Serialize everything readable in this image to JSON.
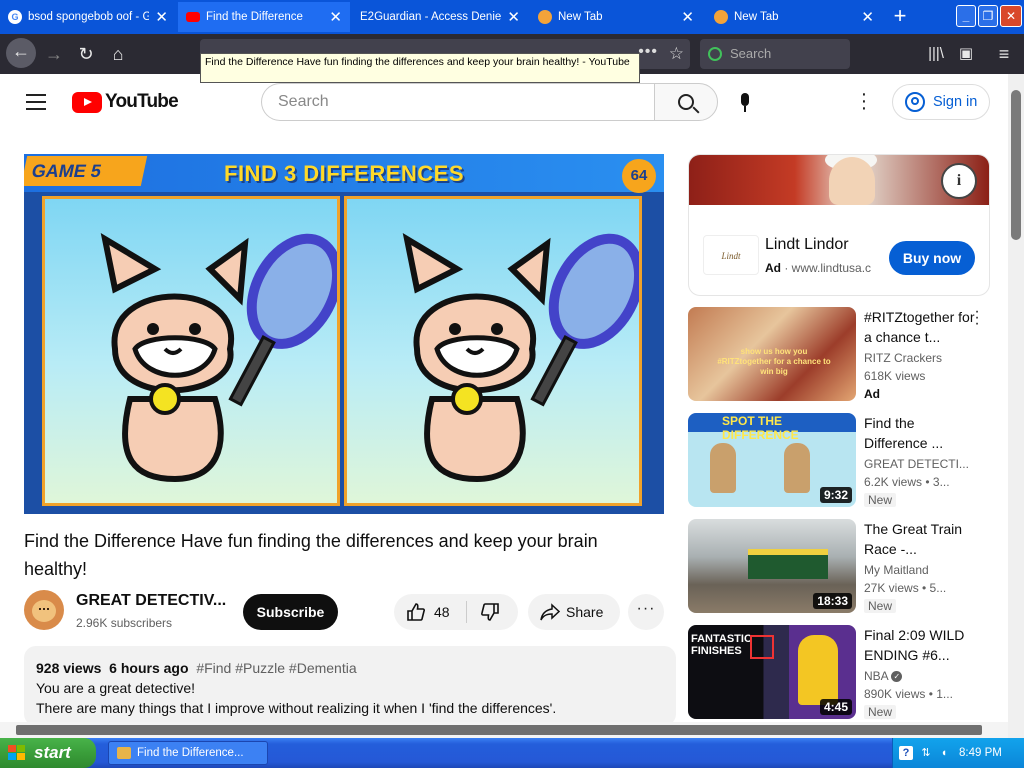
{
  "browser": {
    "tabs": [
      {
        "title": "bsod spongebob oof - G",
        "favicon": "google-icon",
        "active": false
      },
      {
        "title": "Find the Difference",
        "favicon": "youtube-icon",
        "active": true
      },
      {
        "title": "E2Guardian - Access Denied",
        "favicon": "",
        "active": false
      },
      {
        "title": "New Tab",
        "favicon": "firefox-icon",
        "active": false
      },
      {
        "title": "New Tab",
        "favicon": "firefox-icon",
        "active": false
      }
    ],
    "new_tab_label": "+",
    "search_placeholder": "Search",
    "tooltip": "Find the Difference Have fun finding the differences and keep your brain healthy! - YouTube"
  },
  "youtube": {
    "logo_text": "YouTube",
    "search_placeholder": "Search",
    "sign_in": "Sign in"
  },
  "video": {
    "overlay_game": "GAME 5",
    "overlay_title": "FIND 3 DIFFERENCES",
    "overlay_timer": "64",
    "title": "Find the Difference Have fun finding the differences and keep your brain healthy!",
    "channel": "GREAT DETECTIV...",
    "subscribers": "2.96K subscribers",
    "subscribe_label": "Subscribe",
    "likes": "48",
    "share_label": "Share",
    "more_label": "···",
    "views": "928 views",
    "age": "6 hours ago",
    "tags": "#Find #Puzzle #Dementia",
    "desc_line1": "You are a great detective!",
    "desc_line2": "There are many things that I improve without realizing it when I 'find the differences'."
  },
  "ad": {
    "logo": "Lindt",
    "name": "Lindt Lindor",
    "badge": "Ad",
    "url": "www.lindtusa.c",
    "button": "Buy now",
    "info": "i"
  },
  "recommendations": [
    {
      "title": "#RITZtogether for a chance t...",
      "channel": "RITZ Crackers",
      "views": "618K views",
      "badge": "Ad",
      "duration": "",
      "thumb_text": "show us how you #RITZtogether for a chance to win big"
    },
    {
      "title": "Find the Difference ...",
      "channel": "GREAT DETECTI...",
      "views": "6.2K views • 3...",
      "badge": "New",
      "duration": "9:32",
      "thumb_text": "SPOT THE DIFFERENCE"
    },
    {
      "title": "The Great Train Race -...",
      "channel": "My Maitland",
      "views": "27K views • 5...",
      "badge": "New",
      "duration": "18:33",
      "thumb_text": ""
    },
    {
      "title": "Final 2:09 WILD ENDING #6...",
      "channel": "NBA",
      "views": "890K views • 1...",
      "badge": "New",
      "duration": "4:45",
      "thumb_text": "FANTASTIC FINISHES"
    }
  ],
  "taskbar": {
    "start": "start",
    "task": "Find the Difference...",
    "clock": "8:49 PM"
  }
}
